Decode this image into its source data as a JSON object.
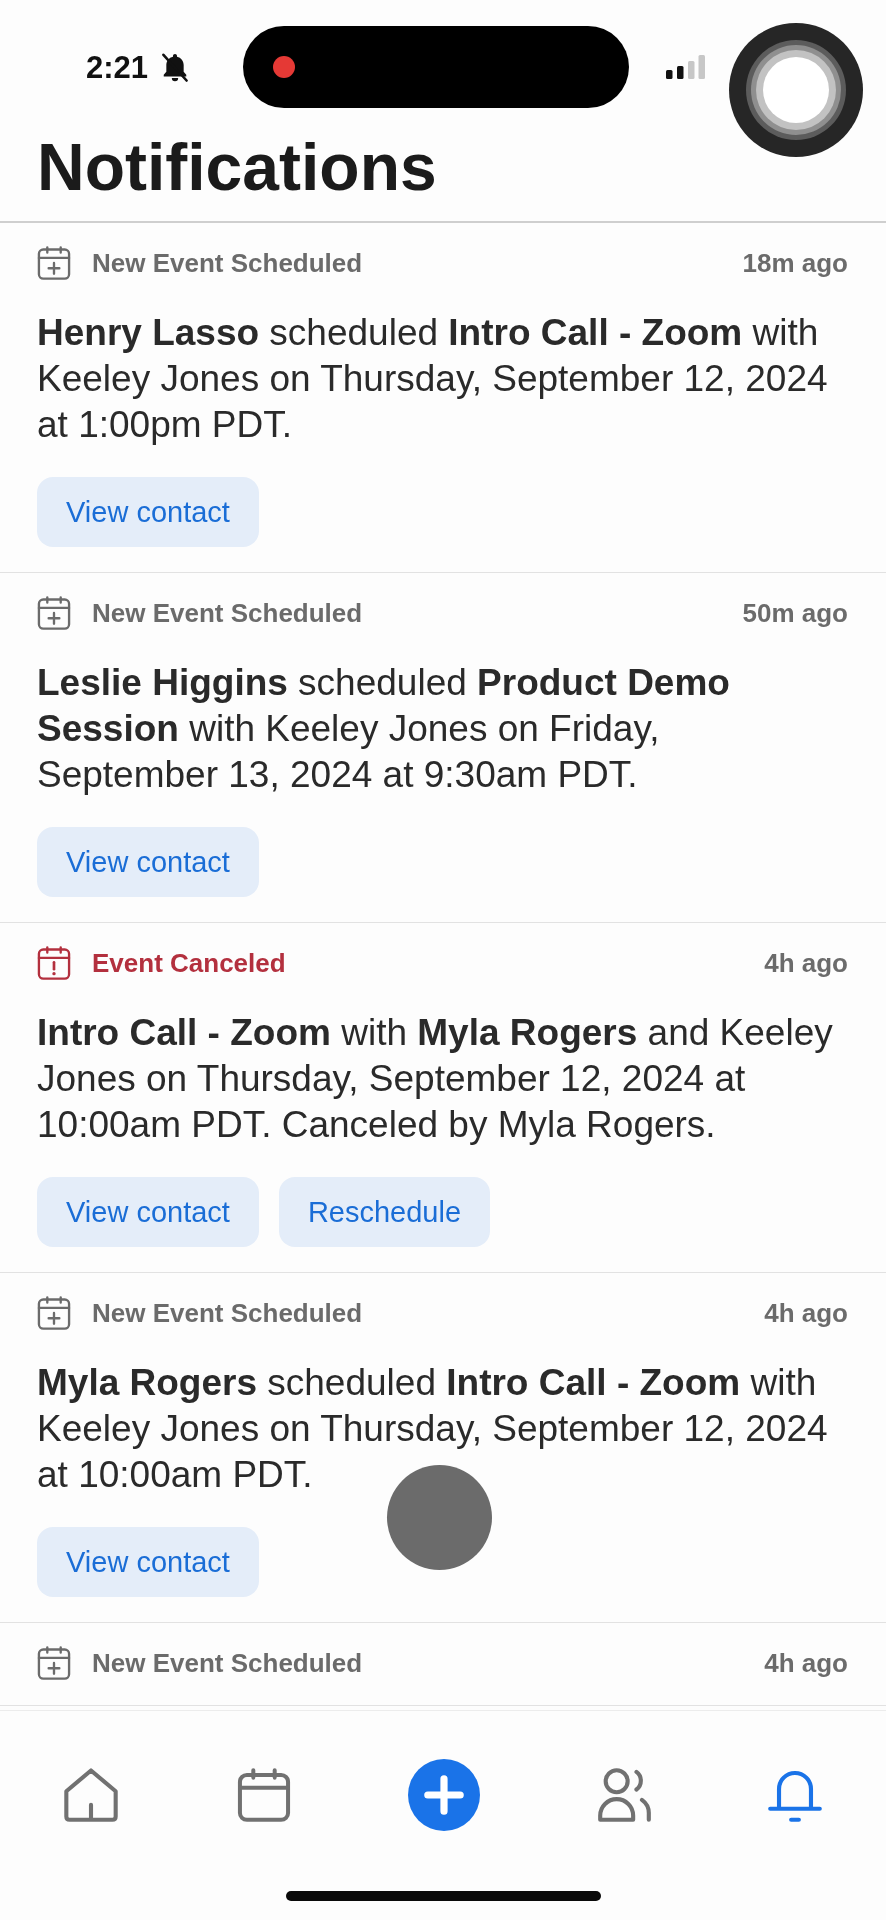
{
  "status_bar": {
    "time": "2:21"
  },
  "title": "Notifications",
  "notifications": [
    {
      "kind": "scheduled",
      "label": "New Event Scheduled",
      "time": "18m ago",
      "message": "**Henry Lasso** scheduled **Intro Call - Zoom** with Keeley Jones on Thursday, September 12, 2024 at 1:00pm PDT.",
      "actions": [
        "View contact"
      ]
    },
    {
      "kind": "scheduled",
      "label": "New Event Scheduled",
      "time": "50m ago",
      "message": "**Leslie Higgins** scheduled **Product Demo Session** with Keeley Jones on Friday, September 13, 2024 at 9:30am PDT.",
      "actions": [
        "View contact"
      ]
    },
    {
      "kind": "canceled",
      "label": "Event Canceled",
      "time": "4h ago",
      "message": "**Intro Call - Zoom** with **Myla Rogers** and Keeley Jones on Thursday, September 12, 2024 at 10:00am PDT. Canceled by Myla Rogers.",
      "actions": [
        "View contact",
        "Reschedule"
      ]
    },
    {
      "kind": "scheduled",
      "label": "New Event Scheduled",
      "time": "4h ago",
      "message": "**Myla Rogers** scheduled **Intro Call - Zoom** with Keeley Jones on Thursday, September 12, 2024 at 10:00am PDT.",
      "actions": [
        "View contact"
      ]
    },
    {
      "kind": "scheduled",
      "label": "New Event Scheduled",
      "time": "4h ago"
    }
  ],
  "tab_bar": {
    "items": [
      {
        "kind": "home",
        "selected": false
      },
      {
        "kind": "calendar",
        "selected": false
      },
      {
        "kind": "add",
        "selected": false
      },
      {
        "kind": "contacts",
        "selected": false
      },
      {
        "kind": "notifications",
        "selected": true
      }
    ]
  }
}
